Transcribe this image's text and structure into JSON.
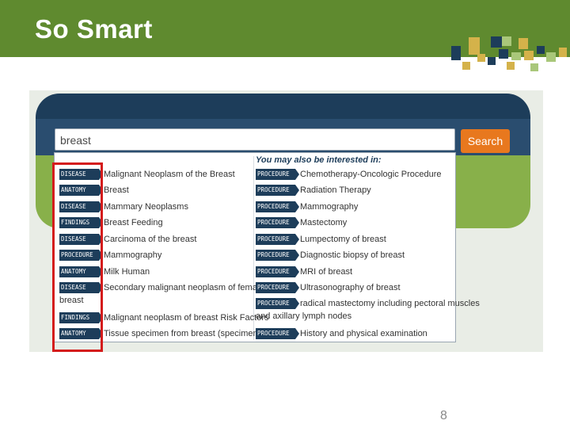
{
  "slide": {
    "title": "So Smart",
    "page_number": "8",
    "header_color": "#5f8a2f"
  },
  "search": {
    "value": "breast",
    "button_label": "Search",
    "button_color": "#e8781e"
  },
  "left_results": [
    {
      "tag": "DISEASE",
      "text": "Malignant Neoplasm of the Breast"
    },
    {
      "tag": "ANATOMY",
      "text": "Breast"
    },
    {
      "tag": "DISEASE",
      "text": "Mammary Neoplasms"
    },
    {
      "tag": "FINDINGS",
      "text": "Breast Feeding"
    },
    {
      "tag": "DISEASE",
      "text": "Carcinoma of the breast"
    },
    {
      "tag": "PROCEDURE",
      "text": "Mammography"
    },
    {
      "tag": "ANATOMY",
      "text": "Milk Human"
    },
    {
      "tag": "DISEASE",
      "text": "Secondary malignant neoplasm of female",
      "cont": "breast"
    },
    {
      "tag": "FINDINGS",
      "text": "Malignant neoplasm of breast Risk Factors"
    },
    {
      "tag": "ANATOMY",
      "text": "Tissue specimen from breast (specimen)"
    }
  ],
  "right_panel": {
    "title": "You may also be interested in:",
    "items": [
      {
        "tag": "PROCEDURE",
        "text": "Chemotherapy-Oncologic Procedure"
      },
      {
        "tag": "PROCEDURE",
        "text": "Radiation Therapy"
      },
      {
        "tag": "PROCEDURE",
        "text": "Mammography"
      },
      {
        "tag": "PROCEDURE",
        "text": "Mastectomy"
      },
      {
        "tag": "PROCEDURE",
        "text": "Lumpectomy of breast"
      },
      {
        "tag": "PROCEDURE",
        "text": "Diagnostic biopsy of breast"
      },
      {
        "tag": "PROCEDURE",
        "text": "MRI of breast"
      },
      {
        "tag": "PROCEDURE",
        "text": "Ultrasonography of breast"
      },
      {
        "tag": "PROCEDURE",
        "text": "radical mastectomy including pectoral muscles",
        "cont": "and axillary lymph nodes"
      },
      {
        "tag": "PROCEDURE",
        "text": "History and physical examination"
      }
    ]
  },
  "highlight_color": "#d41c1c"
}
